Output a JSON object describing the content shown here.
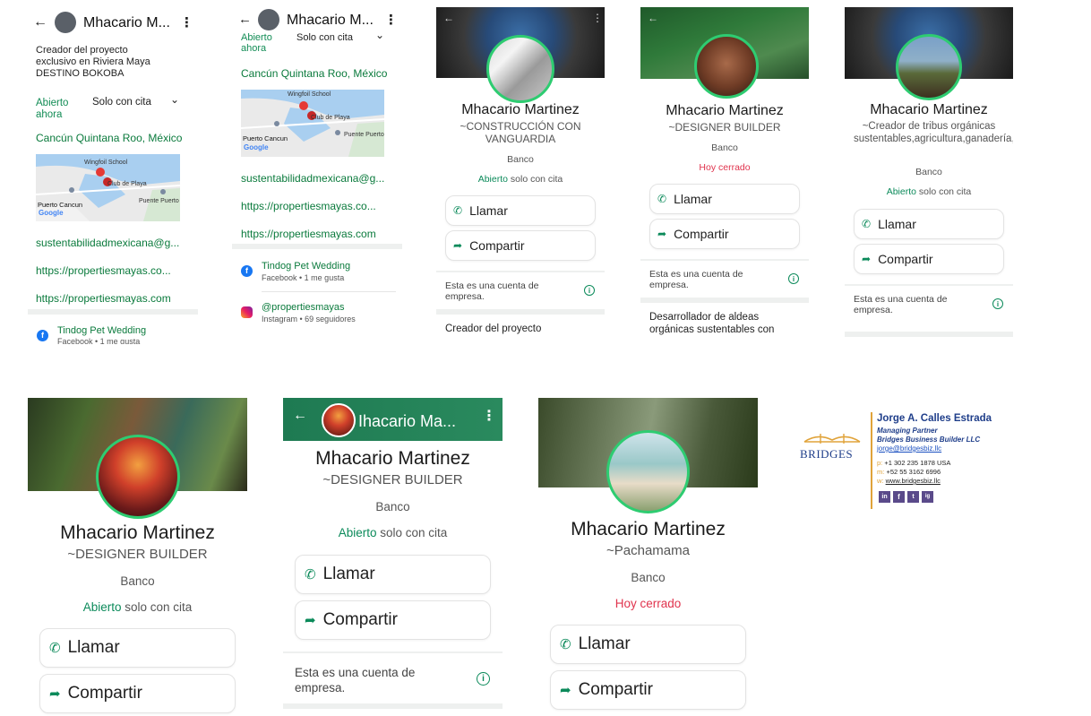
{
  "name": "Mhacario Martinez",
  "header_name_short": "Mhacario M...",
  "header_name_short2": "Mhacario M...",
  "header_name_green": "Ihacario Ma...",
  "profile1": {
    "description": "Creador del proyecto exclusivo en Riviera Maya DESTINO BOKOBA",
    "open_label": "Abierto ahora",
    "hours": "Solo con cita",
    "location": "Cancún Quintana Roo, México",
    "map_labels": [
      "Wingfoil School",
      "Club de Playa",
      "Puerto Cancun",
      "Puente Puerto",
      "Google"
    ],
    "links": [
      "sustentabilidadmexicana@g...",
      "https://propertiesmayas.co...",
      "https://propertiesmayas.com"
    ],
    "social_name": "Tindog Pet Wedding",
    "social_meta": "Facebook • 1 me gusta"
  },
  "profile2": {
    "open_label": "Abierto ahora",
    "hours": "Solo con cita",
    "location": "Cancún Quintana Roo, México",
    "map_labels": [
      "Wingfoil School",
      "Club de Playa",
      "Puerto Cancun",
      "Puente Puerto",
      "Google"
    ],
    "links": [
      "sustentabilidadmexicana@g...",
      "https://propertiesmayas.co...",
      "https://propertiesmayas.com"
    ],
    "social": [
      {
        "name": "Tindog Pet Wedding",
        "meta": "Facebook • 1 me gusta"
      },
      {
        "name": "@propertiesmayas",
        "meta": "Instagram • 69 seguidores"
      }
    ]
  },
  "profile3": {
    "tagline": "~CONSTRUCCIÓN CON VANGUARDIA",
    "category": "Banco",
    "status_green": "Abierto",
    "status_rest": " solo con cita",
    "call": "Llamar",
    "share": "Compartir",
    "business_note": "Esta es una cuenta de empresa.",
    "about": "Creador del proyecto"
  },
  "profile4": {
    "tagline": "~DESIGNER BUILDER",
    "category": "Banco",
    "status": "Hoy cerrado",
    "call": "Llamar",
    "share": "Compartir",
    "business_note": "Esta es una cuenta de empresa.",
    "about": "Desarrollador de aldeas orgánicas sustentables con"
  },
  "profile5": {
    "tagline": "~Creador de tribus orgánicas sustentables,agricultura,ganadería,cultura",
    "category": "Banco",
    "status_green": "Abierto",
    "status_rest": " solo con cita",
    "call": "Llamar",
    "share": "Compartir",
    "business_note": "Esta es una cuenta de empresa."
  },
  "profile6": {
    "tagline": "~DESIGNER BUILDER",
    "category": "Banco",
    "status_green": "Abierto",
    "status_rest": " solo con cita",
    "call": "Llamar",
    "share": "Compartir"
  },
  "profile7": {
    "tagline": "~DESIGNER BUILDER",
    "category": "Banco",
    "status_green": "Abierto",
    "status_rest": " solo con cita",
    "call": "Llamar",
    "share": "Compartir",
    "business_note": "Esta es una cuenta de empresa."
  },
  "profile8": {
    "tagline": "~Pachamama",
    "category": "Banco",
    "status": "Hoy cerrado",
    "call": "Llamar",
    "share": "Compartir"
  },
  "signature": {
    "logo_text": "BRIDGES",
    "person": "Jorge A. Calles Estrada",
    "role": "Managing Partner",
    "company": "Bridges Business Builder LLC",
    "email": "jorge@bridgesbiz.llc",
    "phone_label": "p:",
    "phone": "+1 302 235 1878 USA",
    "mobile_label": "m:",
    "mobile": "+52 55 3162 6996",
    "web_label": "w:",
    "web": "www.bridgesbiz.llc",
    "social_icons": [
      "in",
      "f",
      "t",
      "ig"
    ]
  },
  "colors": {
    "accent_green": "#128c55",
    "ring_green": "#2ecc71",
    "closed_red": "#e0334d",
    "header_green": "#1e7a52",
    "signature_blue": "#1f3e8a",
    "signature_gold": "#e0a33a"
  }
}
